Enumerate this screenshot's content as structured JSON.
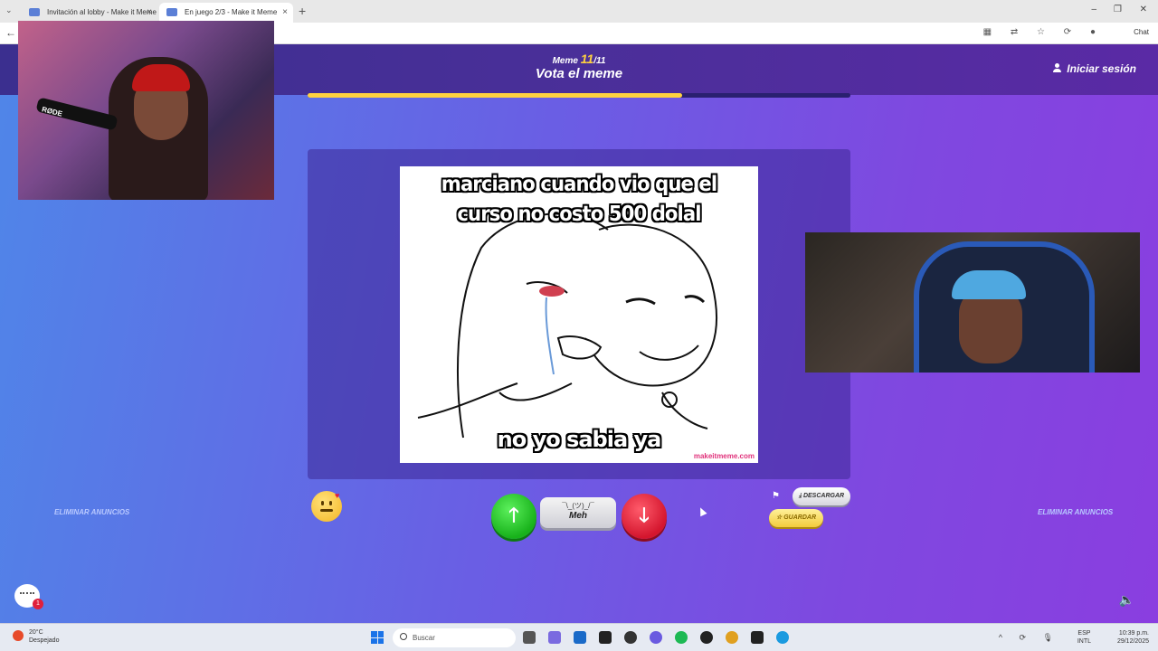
{
  "browser": {
    "tabs": [
      {
        "title": "Invitación al lobby - Make it Meme",
        "active": false
      },
      {
        "title": "En juego 2/3 - Make it Meme",
        "active": true
      }
    ],
    "chat_label": "Chat"
  },
  "header": {
    "meme_label": "Meme",
    "meme_current": "11",
    "meme_total": "/11",
    "title": "Vota el meme",
    "login_label": "Iniciar sesión",
    "progress_fraction": 0.69
  },
  "meme": {
    "top_text": "marciano cuando vio que el curso no costo 500 dolal",
    "bottom_text": "no yo sabia ya",
    "watermark": "makeitmeme.com"
  },
  "vote": {
    "up_glyph": "🡑",
    "down_glyph": "🡓",
    "meh_face": "¯\\_(ツ)_/¯",
    "meh_label": "Meh"
  },
  "actions": {
    "download_label": "DESCARGAR",
    "save_label": "GUARDAR",
    "remove_ads_left": "ELIMINAR ANUNCIOS",
    "remove_ads_right": "ELIMINAR ANUNCIOS",
    "chat_badge": "1"
  },
  "webcam": {
    "mic_label": "RØDE"
  },
  "taskbar": {
    "weather_temp": "20°C",
    "weather_desc": "Despejado",
    "search_placeholder": "Buscar",
    "lang_top": "ESP",
    "lang_bottom": "INTL",
    "time": "10:39 p.m.",
    "date": "29/12/2025"
  },
  "colors": {
    "accent_yellow": "#ffd23f",
    "vote_up": "#18b21b",
    "vote_down": "#d4162e"
  }
}
